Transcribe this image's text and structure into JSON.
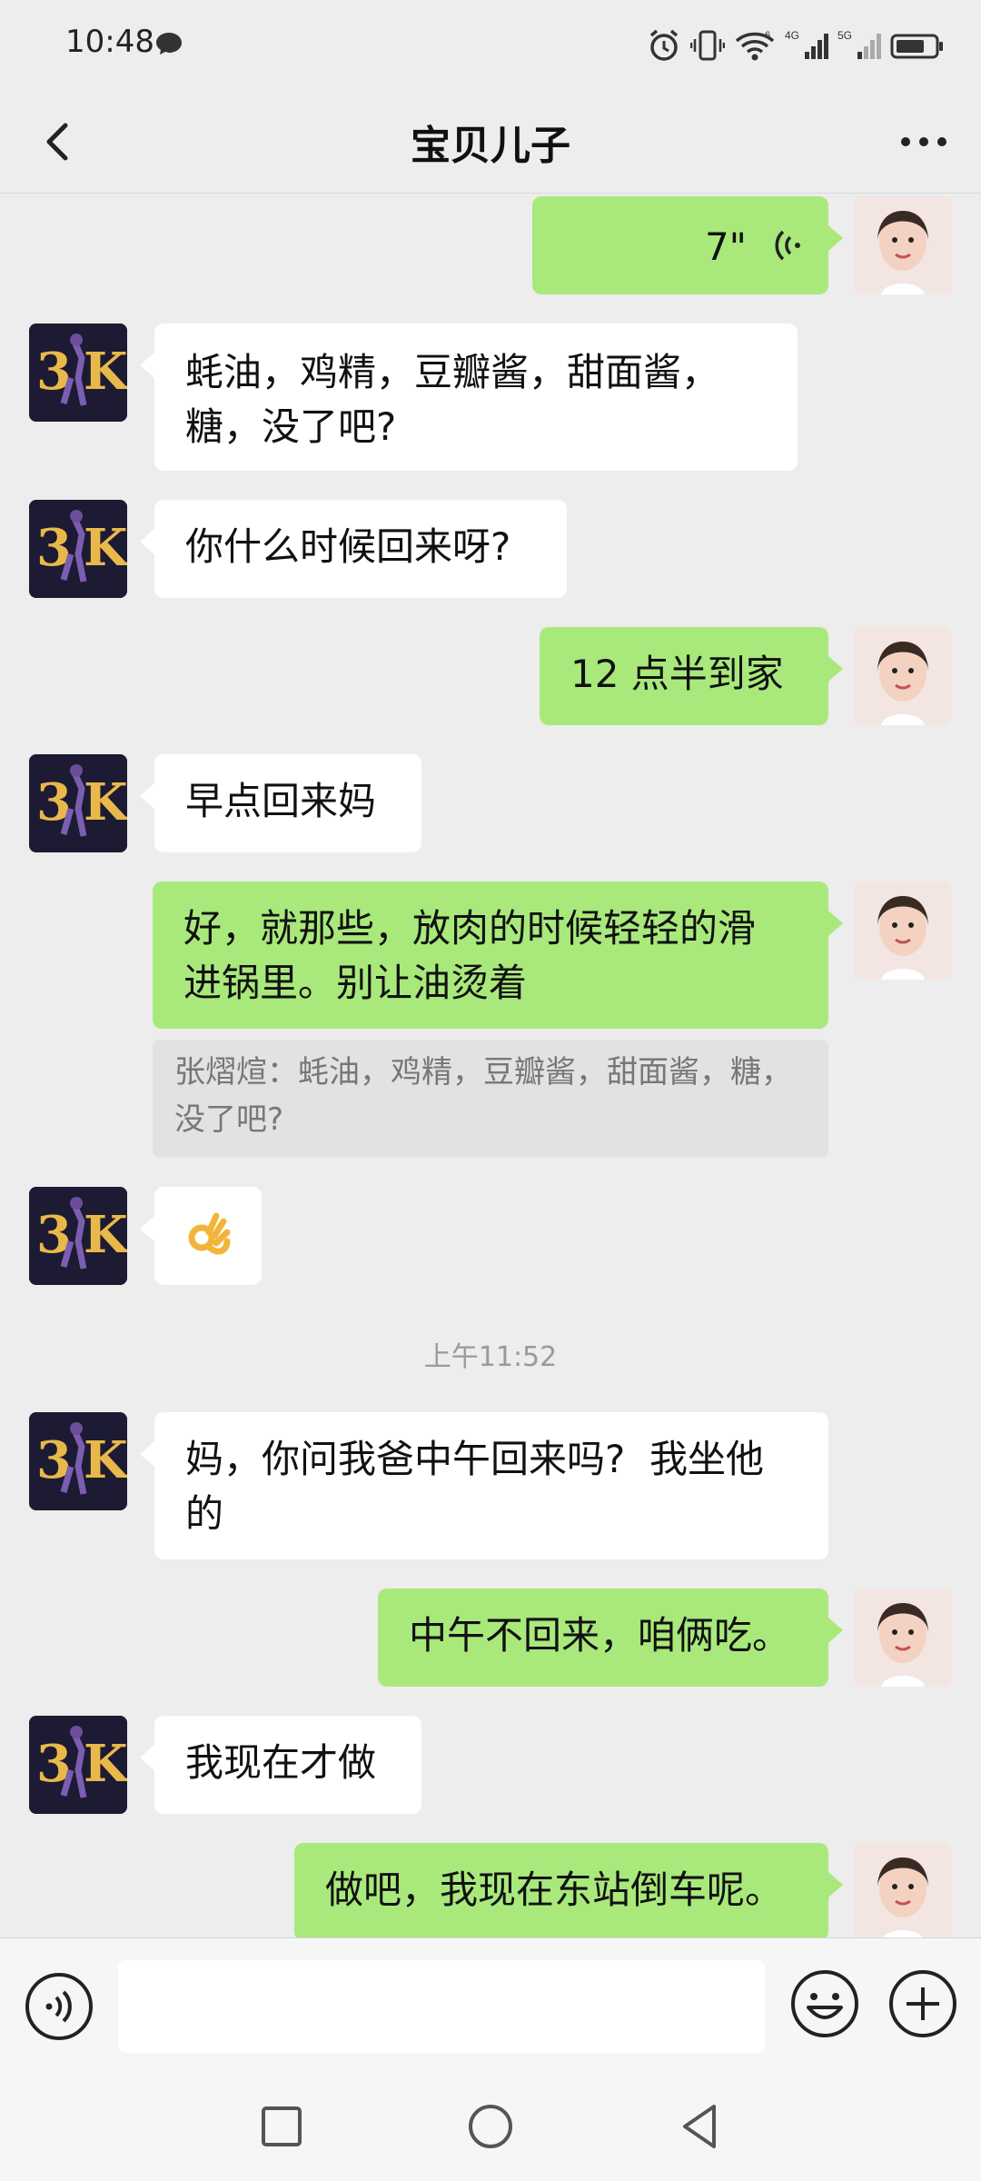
{
  "status_bar": {
    "time": "10:48",
    "signal_labels": [
      "6",
      "4G",
      "5G"
    ]
  },
  "nav": {
    "title": "宝贝儿子"
  },
  "messages": [
    {
      "from": "me",
      "type": "voice",
      "duration": "7\""
    },
    {
      "from": "them",
      "lines": [
        "蚝油，鸡精，豆瓣酱，甜面酱，",
        "糖，没了吧?"
      ]
    },
    {
      "from": "them",
      "lines": [
        "你什么时候回来呀?"
      ]
    },
    {
      "from": "me",
      "lines": [
        "12 点半到家"
      ]
    },
    {
      "from": "them",
      "lines": [
        "早点回来妈"
      ]
    },
    {
      "from": "me",
      "lines": [
        "好，就那些，放肉的时候轻轻的滑",
        "进锅里。别让油烫着"
      ],
      "quote_lines": [
        "张熠煊：蚝油，鸡精，豆瓣酱，甜面酱，糖，",
        "没了吧?"
      ]
    },
    {
      "from": "them",
      "type": "emoji",
      "emoji": "👌"
    },
    {
      "from": "them",
      "lines": [
        "妈，你问我爸中午回来吗?  我坐他",
        "的"
      ]
    },
    {
      "from": "me",
      "lines": [
        "中午不回来，咱俩吃。"
      ]
    },
    {
      "from": "them",
      "lines": [
        "我现在才做"
      ]
    },
    {
      "from": "me",
      "lines": [
        "做吧，我现在东站倒车呢。"
      ]
    }
  ],
  "timestamp": "上午11:52",
  "input": {
    "value": "",
    "placeholder": ""
  },
  "icons": {
    "back": "back-arrow-icon",
    "more": "more-dots-icon",
    "voice": "voice-input-icon",
    "emoji": "emoji-icon",
    "plus": "plus-icon"
  },
  "colors": {
    "my_bubble": "#a9e97c",
    "their_bubble": "#ffffff",
    "background": "#ededed"
  }
}
